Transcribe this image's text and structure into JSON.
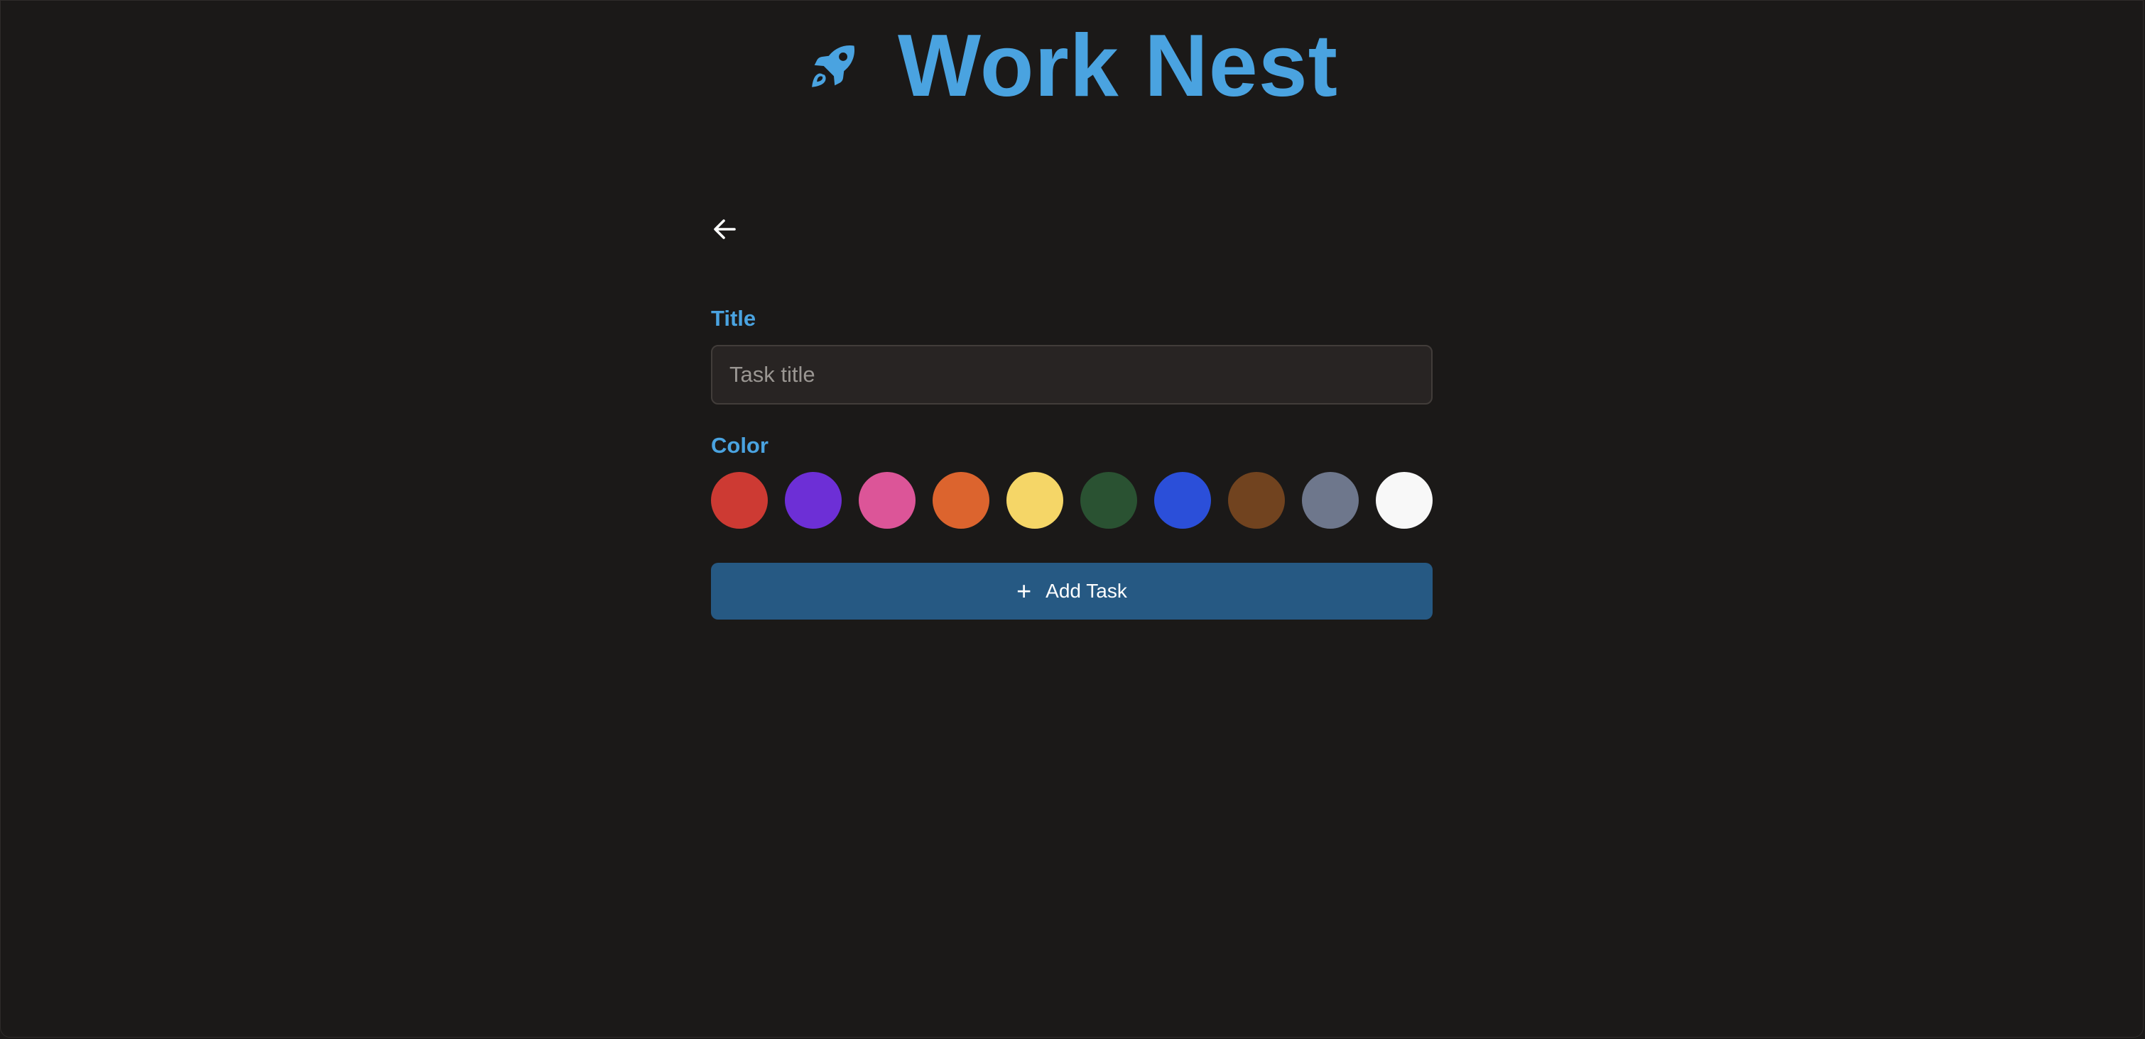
{
  "header": {
    "logo_icon": "rocket-icon",
    "title": "Work Nest",
    "accent_color": "#4aa3e0"
  },
  "form": {
    "back_icon": "arrow-left-icon",
    "title_label": "Title",
    "title_input": {
      "value": "",
      "placeholder": "Task title"
    },
    "color_label": "Color",
    "colors": [
      {
        "name": "red",
        "hex": "#cd3a33"
      },
      {
        "name": "purple",
        "hex": "#6d2fd6"
      },
      {
        "name": "pink",
        "hex": "#dc5598"
      },
      {
        "name": "orange",
        "hex": "#dc642e"
      },
      {
        "name": "yellow",
        "hex": "#f5d667"
      },
      {
        "name": "dark-green",
        "hex": "#2a5232"
      },
      {
        "name": "blue",
        "hex": "#2b4fd9"
      },
      {
        "name": "brown",
        "hex": "#71431f"
      },
      {
        "name": "slate",
        "hex": "#6e778c"
      },
      {
        "name": "white",
        "hex": "#f8f8f8"
      }
    ],
    "submit": {
      "icon": "plus-icon",
      "label": "Add Task",
      "color": "#265983"
    }
  }
}
